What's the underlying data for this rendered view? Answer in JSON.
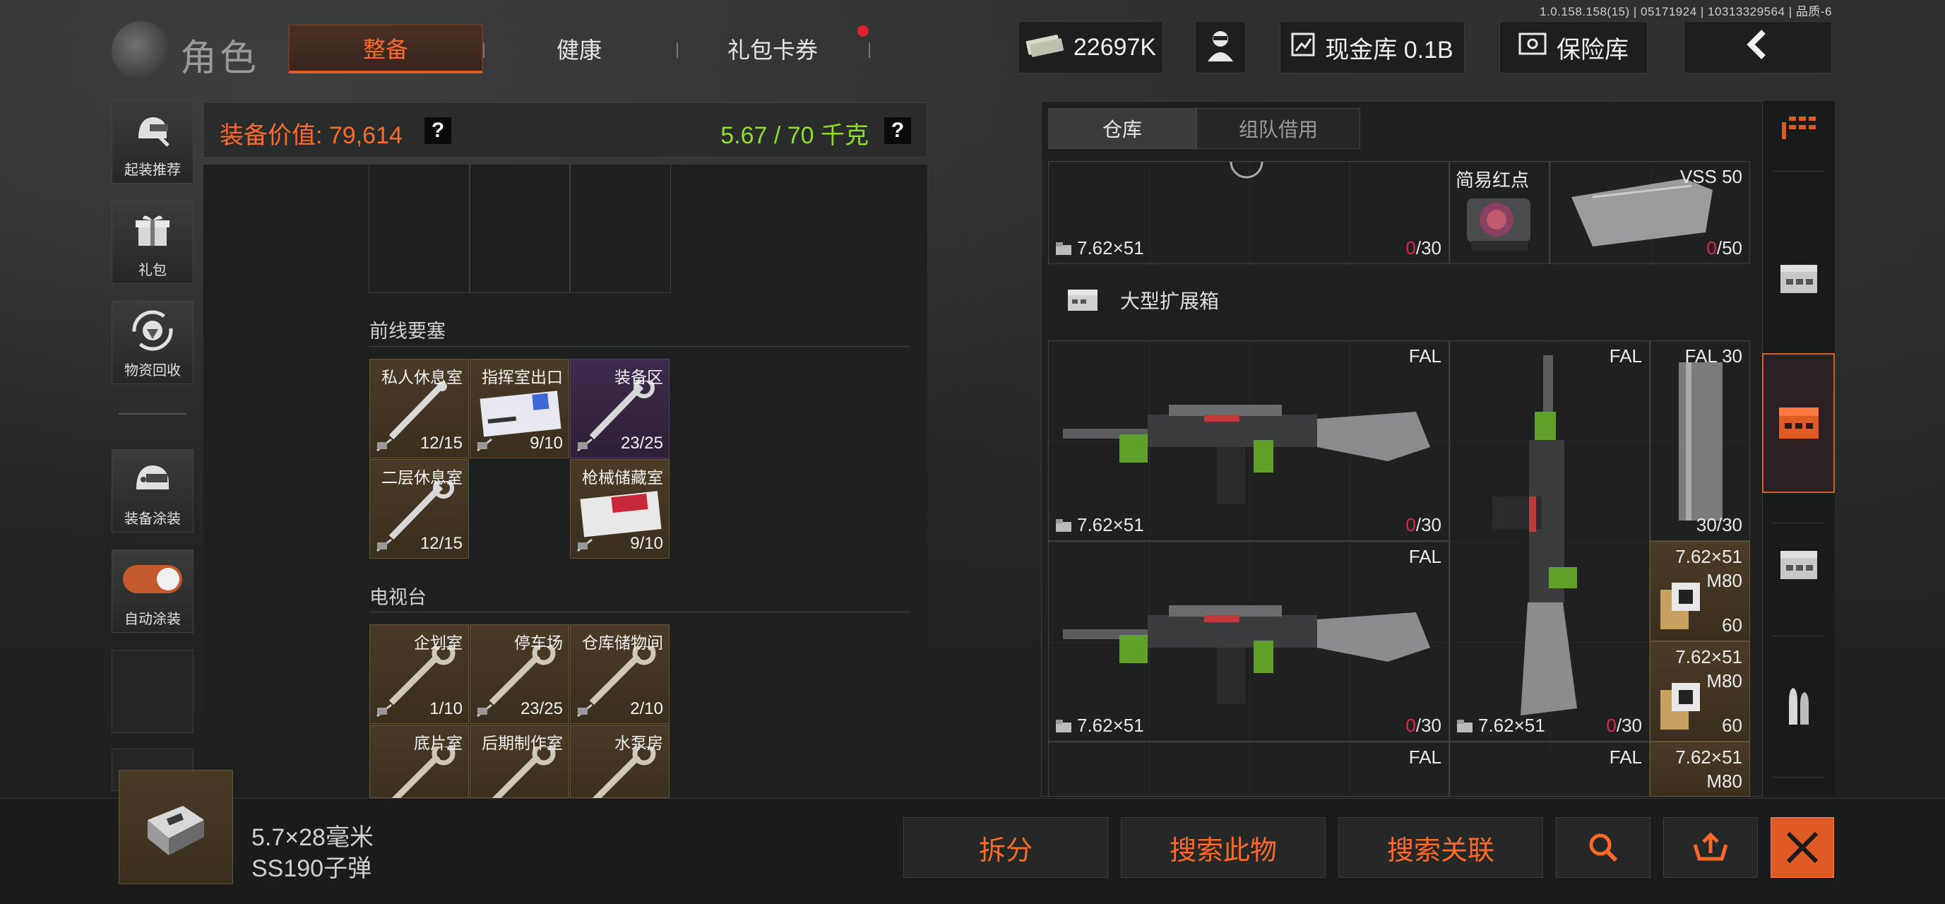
{
  "version": "1.0.158.158(15) | 05171924 | 10313329564 | 品质-6",
  "header": {
    "title": "角色",
    "tabs": [
      {
        "label": "整备",
        "active": true
      },
      {
        "label": "健康",
        "active": false
      },
      {
        "label": "礼包卡券",
        "active": false,
        "notification": true
      }
    ],
    "currency": "22697K",
    "cash_vault": "现金库 0.1B",
    "safe": "保险库"
  },
  "sidebar": {
    "items": [
      {
        "label": "起装推荐",
        "icon": "helmet-recommend-icon"
      },
      {
        "label": "礼包",
        "icon": "gift-icon"
      },
      {
        "label": "物资回收",
        "icon": "recycle-icon"
      },
      {
        "label": "装备涂装",
        "icon": "helmet-paint-icon"
      },
      {
        "label": "自动涂装",
        "icon": "toggle-icon",
        "toggle_on": true
      }
    ]
  },
  "left_panel": {
    "equip_value_label": "装备价值: 79,614",
    "weight_label": "5.67 / 70 千克",
    "help": "?",
    "sections": [
      {
        "title": "前线要塞",
        "keys": [
          {
            "name": "私人休息室",
            "count": "12/15",
            "style": "gold"
          },
          {
            "name": "指挥室出口",
            "count": "9/10",
            "style": "card"
          },
          {
            "name": "装备区",
            "count": "23/25",
            "style": "purple"
          },
          {
            "name": "二层休息室",
            "count": "12/15",
            "style": "gold"
          },
          {
            "name": "枪械储藏室",
            "count": "9/10",
            "style": "card"
          }
        ]
      },
      {
        "title": "电视台",
        "keys": [
          {
            "name": "企划室",
            "count": "1/10"
          },
          {
            "name": "停车场",
            "count": "23/25"
          },
          {
            "name": "仓库储物间",
            "count": "2/10"
          },
          {
            "name": "底片室",
            "count": ""
          },
          {
            "name": "后期制作室",
            "count": ""
          },
          {
            "name": "水泵房",
            "count": ""
          }
        ]
      }
    ]
  },
  "right_panel": {
    "tabs": [
      {
        "label": "仓库",
        "active": true
      },
      {
        "label": "组队借用",
        "active": false
      }
    ],
    "top_row": [
      {
        "name": "",
        "caliber": "7.62×51",
        "ammo_loaded": "0",
        "ammo_cap": "/30"
      },
      {
        "name": "简易红点",
        "caliber": "",
        "ammo_loaded": "",
        "ammo_cap": ""
      },
      {
        "name": "VSS 50",
        "caliber": "",
        "ammo_loaded": "0",
        "ammo_cap": "/50"
      }
    ],
    "container_label": "大型扩展箱",
    "items": [
      {
        "name": "FAL",
        "caliber": "7.62×51",
        "ammo_loaded": "0",
        "ammo_cap": "/30"
      },
      {
        "name": "FAL",
        "caliber": "7.62×51",
        "ammo_loaded": "0",
        "ammo_cap": "/30"
      },
      {
        "name": "FAL 30",
        "caliber": "",
        "ammo_loaded": "",
        "ammo_cap": "30/30"
      },
      {
        "name": "FAL",
        "caliber": "7.62×51",
        "ammo_loaded": "0",
        "ammo_cap": "/30"
      },
      {
        "name": "7.62×51",
        "sub": "M80",
        "count": "60"
      },
      {
        "name": "7.62×51",
        "sub": "M80",
        "count": "60"
      },
      {
        "name": "FAL",
        "caliber": "",
        "ammo_loaded": "",
        "ammo_cap": ""
      },
      {
        "name": "FAL",
        "caliber": "",
        "ammo_loaded": "",
        "ammo_cap": ""
      },
      {
        "name": "7.62×51",
        "sub": "M80",
        "count": ""
      }
    ]
  },
  "selected_item": {
    "line1": "5.7×28毫米",
    "line2": "SS190子弹"
  },
  "actions": {
    "split": "拆分",
    "search_item": "搜索此物",
    "search_related": "搜索关联"
  },
  "colors": {
    "accent": "#e05a24",
    "value_orange": "#ff6a2a",
    "weight_green": "#8fdc2a",
    "ammo_zero": "#e2244a"
  }
}
